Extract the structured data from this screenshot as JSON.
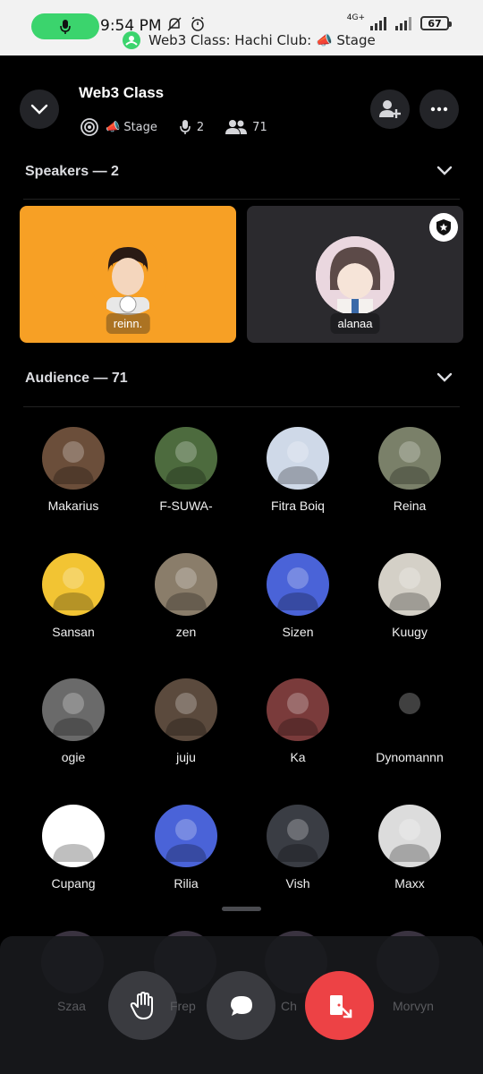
{
  "status_bar": {
    "time": "9:54 PM",
    "network": "4G+",
    "battery": "67",
    "ongoing_label": "Web3 Class: Hachi Club: 📣 Stage"
  },
  "header": {
    "title": "Web3 Class",
    "stage_label": "📣 Stage",
    "speaker_count": "2",
    "listener_count": "71"
  },
  "speakers_section": {
    "title": "Speakers — 2",
    "speakers": [
      {
        "name": "reinn.",
        "bg": "#f7a025"
      },
      {
        "name": "alanaa",
        "bg": "#2b2a2e"
      }
    ]
  },
  "audience_section": {
    "title": "Audience — 71",
    "members": [
      {
        "name": "Makarius",
        "color": "#6b4e3a"
      },
      {
        "name": "F-SUWA-",
        "color": "#4d6b3e"
      },
      {
        "name": "Fitra Boiq",
        "color": "#cfd9e8"
      },
      {
        "name": "Reina",
        "color": "#7a8069"
      },
      {
        "name": "Sansan",
        "color": "#f2c433"
      },
      {
        "name": "zen",
        "color": "#8a7d6a"
      },
      {
        "name": "Sizen",
        "color": "#4a63d8"
      },
      {
        "name": "Kuugy",
        "color": "#d4d0c7"
      },
      {
        "name": "ogie",
        "color": "#6a6a6a"
      },
      {
        "name": "juju",
        "color": "#5b4a3d"
      },
      {
        "name": "Ka",
        "color": "#7a3b3b"
      },
      {
        "name": "Dynomannn",
        "color": "#000000"
      },
      {
        "name": "Cupang",
        "color": "#ffffff"
      },
      {
        "name": "Rilia",
        "color": "#4a63d8"
      },
      {
        "name": "Vish",
        "color": "#3a3d44"
      },
      {
        "name": "Maxx",
        "color": "#dcdcdc"
      }
    ]
  },
  "partial_row": [
    "Szaa",
    "Frep",
    "Ch",
    "Morvyn"
  ],
  "actions": {
    "raise_hand": "raise-hand",
    "chat": "chat",
    "leave": "leave"
  },
  "colors": {
    "accent_green": "#3bd46d",
    "leave_red": "#ed4245",
    "button_gray": "#3a3b40"
  }
}
